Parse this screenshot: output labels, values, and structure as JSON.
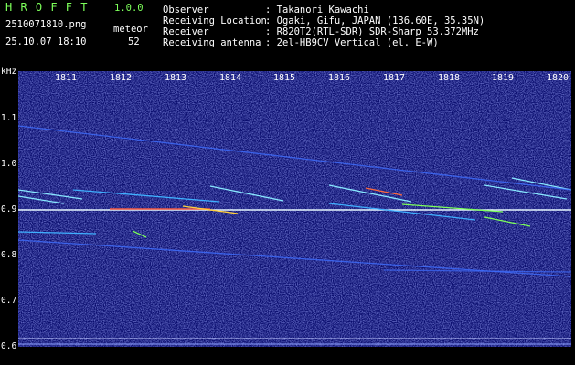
{
  "header": {
    "app_name": "H R O F F T",
    "version": "1.0.0",
    "file_name": "2510071810.png",
    "datetime": "25.10.07 18:10",
    "meteor_label": "meteor",
    "meteor_count": "52",
    "info_labels": [
      "Observer",
      "Receiving Location",
      "Receiver",
      "Receiving antenna"
    ],
    "info_values": [
      ": Takanori Kawachi",
      ": Ogaki, Gifu, JAPAN (136.60E, 35.35N)",
      ": R820T2(RTL-SDR) SDR-Sharp 53.372MHz",
      ": 2el-HB9CV Vertical (el. E-W)"
    ]
  },
  "axis": {
    "y_unit": "kHz",
    "y_ticks": [
      "1.1",
      "1.0",
      "0.9",
      "0.8",
      "0.7",
      "0.6"
    ],
    "x_ticks": [
      "1811",
      "1812",
      "1813",
      "1814",
      "1815",
      "1816",
      "1817",
      "1818",
      "1819",
      "1820"
    ]
  },
  "colors": {
    "background": "#000000",
    "spectrum_bg": "#0a0d6e",
    "header_green": "#7cff5a",
    "signal_yellow": "#ffff00",
    "signal_cyan": "#00e5ff"
  }
}
